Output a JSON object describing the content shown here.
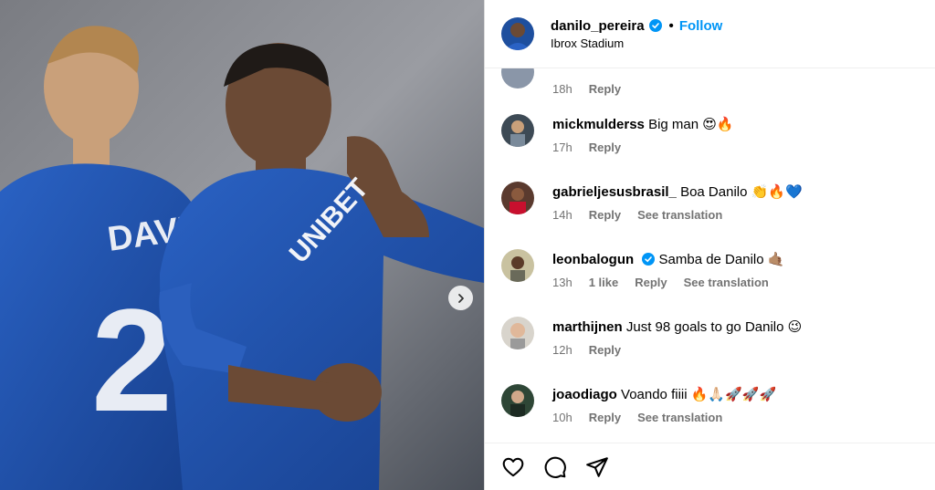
{
  "post": {
    "username": "danilo_pereira",
    "dot": "•",
    "follow_label": "Follow",
    "location": "Ibrox Stadium"
  },
  "comments": [
    {
      "user": "",
      "text": "",
      "time": "18h",
      "likes": "",
      "reply": "Reply",
      "translate": ""
    },
    {
      "user": "mickmulderss",
      "text": "Big man 😍🔥",
      "time": "17h",
      "likes": "",
      "reply": "Reply",
      "translate": ""
    },
    {
      "user": "gabrieljesusbrasil_",
      "text": "Boa Danilo 👏🔥💙",
      "time": "14h",
      "likes": "",
      "reply": "Reply",
      "translate": "See translation"
    },
    {
      "user": "leonbalogun",
      "text": "Samba de Danilo 🤙🏽",
      "time": "13h",
      "likes": "1 like",
      "reply": "Reply",
      "translate": "See translation"
    },
    {
      "user": "marthijnen",
      "text": "Just 98 goals to go Danilo 😉",
      "time": "12h",
      "likes": "",
      "reply": "Reply",
      "translate": ""
    },
    {
      "user": "joaodiago",
      "text": "Voando fiiii 🔥🙏🏻🚀🚀🚀",
      "time": "10h",
      "likes": "",
      "reply": "Reply",
      "translate": "See translation"
    }
  ],
  "photo": {
    "jersey_text": "UNIBET",
    "back_name": "DAVIES",
    "back_number": "2"
  },
  "colors": {
    "accent": "#0095f6",
    "muted": "#737373",
    "jersey": "#1f4fa8"
  },
  "icons": [
    "heart-icon",
    "comment-icon",
    "share-icon",
    "chevron-right-icon",
    "verified-badge-icon"
  ]
}
